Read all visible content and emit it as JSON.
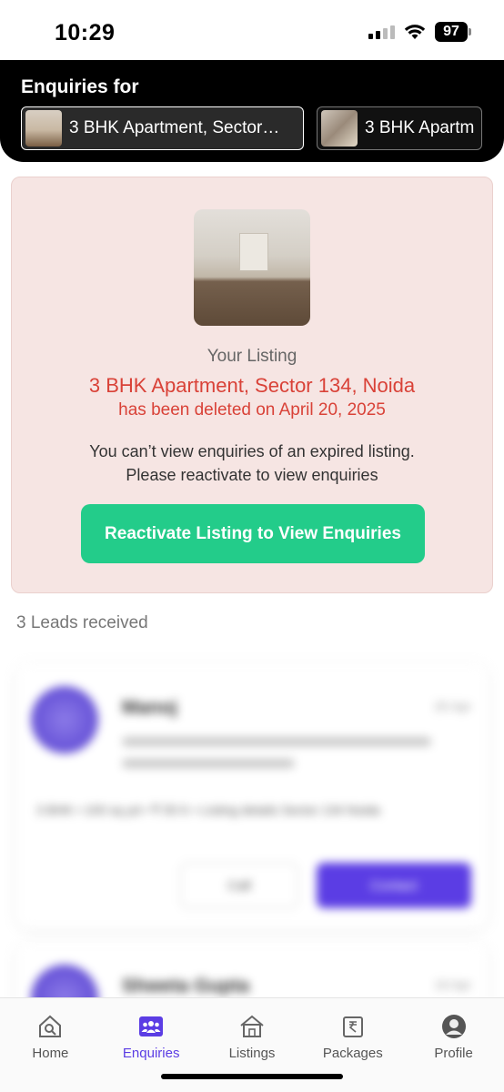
{
  "status_bar": {
    "time": "10:29",
    "battery": "97"
  },
  "header": {
    "title": "Enquiries for",
    "chips": [
      {
        "label": "3 BHK Apartment, Sector…"
      },
      {
        "label": "3 BHK Apartm"
      }
    ]
  },
  "alert": {
    "label": "Your Listing",
    "listing_title": "3 BHK Apartment, Sector 134, Noida",
    "deleted_text": "has been deleted on April 20, 2025",
    "message_line1": "You can’t view enquiries of an expired listing.",
    "message_line2": "Please reactivate to view enquiries",
    "button_label": "Reactivate Listing to View Enquiries"
  },
  "leads": {
    "count_text": "3 Leads received"
  },
  "blurred_leads": [
    {
      "name": "Manoj",
      "date": "20 Apr",
      "detail": "3 BHK • 100 sq yd • ₹ 55 K • Listing details Sector 134 Noida",
      "call": "Call",
      "action": "Contact"
    },
    {
      "name": "Shweta Gupta",
      "date": "19 Apr"
    }
  ],
  "bottom_nav": {
    "items": [
      {
        "label": "Home",
        "icon": "home-search-icon"
      },
      {
        "label": "Enquiries",
        "icon": "people-group-icon"
      },
      {
        "label": "Listings",
        "icon": "house-icon"
      },
      {
        "label": "Packages",
        "icon": "rupee-document-icon"
      },
      {
        "label": "Profile",
        "icon": "user-avatar-icon"
      }
    ],
    "active": "Enquiries"
  },
  "colors": {
    "accent": "#5b3de4",
    "alert_text": "#d94238",
    "alert_background": "#f6e5e3",
    "reactivate_button": "#23cc8a",
    "header_background": "#000000"
  }
}
